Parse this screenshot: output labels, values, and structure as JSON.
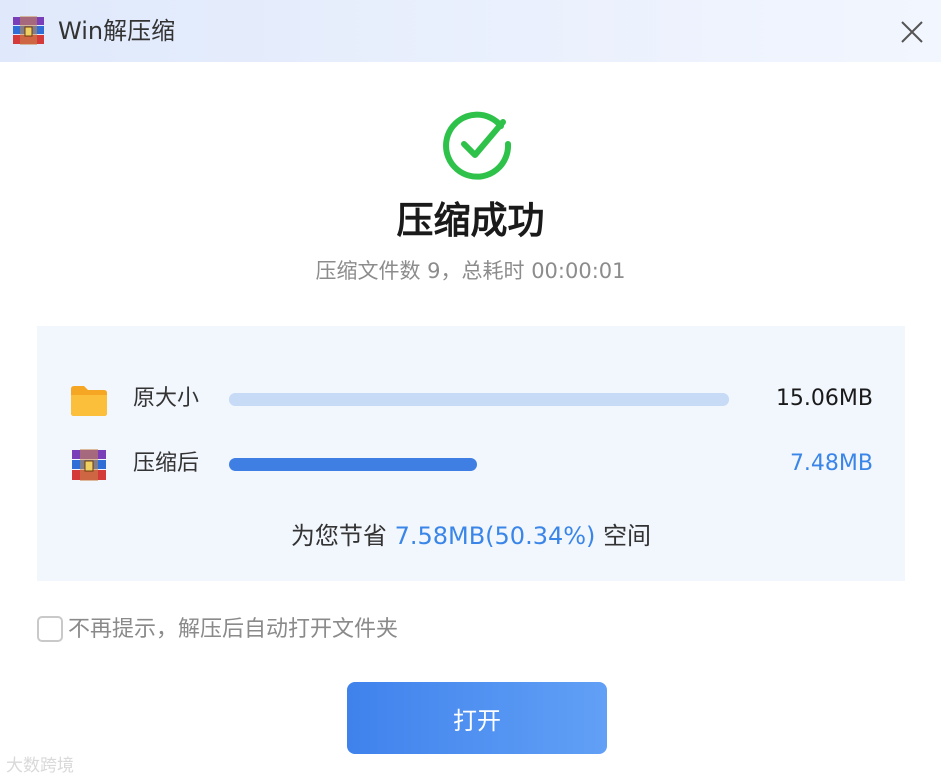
{
  "window": {
    "title": "Win解压缩",
    "logo_icon": "winrar-archive-icon",
    "close_icon": "close-icon"
  },
  "result": {
    "status_icon": "check-circle-icon",
    "heading": "压缩成功",
    "summary": "压缩文件数 9，总耗时 00:00:01"
  },
  "stats": {
    "original": {
      "icon": "folder-icon",
      "label": "原大小",
      "value": "15.06MB",
      "bar_fraction": 1.0
    },
    "compressed": {
      "icon": "winrar-archive-icon",
      "label": "压缩后",
      "value": "7.48MB",
      "bar_fraction": 0.4966
    },
    "saving": {
      "prefix": "为您节省",
      "amount": "7.58MB(50.34%)",
      "suffix": "空间"
    }
  },
  "options": {
    "dont_show_again": {
      "label": "不再提示，解压后自动打开文件夹",
      "checked": false
    }
  },
  "actions": {
    "open_label": "打开"
  },
  "watermark": "大数跨境",
  "colors": {
    "accent": "#3a86e8",
    "success": "#2ec24a",
    "bar_track": "#c8dbf6",
    "bar_fill": "#3f7fe3",
    "panel_bg": "#f2f6fd"
  }
}
